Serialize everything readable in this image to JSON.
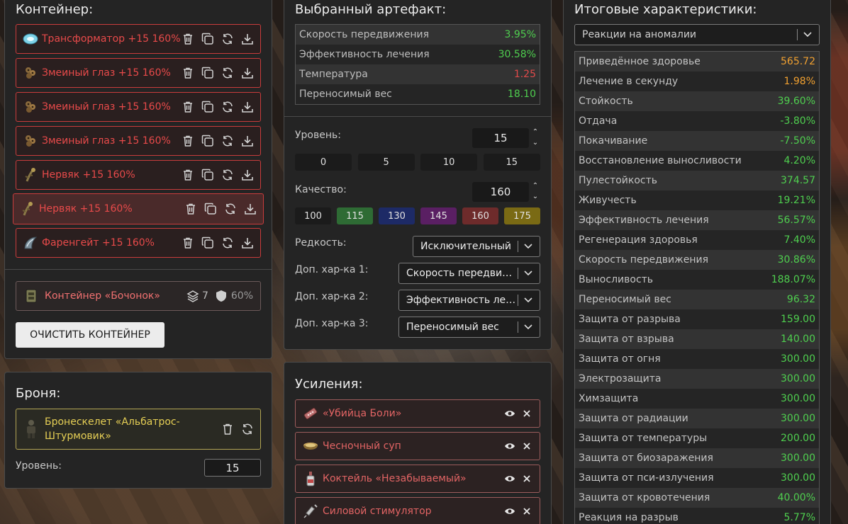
{
  "container_panel": {
    "title": "Контейнер:",
    "items": [
      {
        "name": "Трансформатор +15 160%",
        "icon": "transformer-artifact-icon"
      },
      {
        "name": "Змеиный глаз +15 160%",
        "icon": "snake-eye-artifact-icon"
      },
      {
        "name": "Змеиный глаз +15 160%",
        "icon": "snake-eye-artifact-icon"
      },
      {
        "name": "Змеиный глаз +15 160%",
        "icon": "snake-eye-artifact-icon"
      },
      {
        "name": "Нервяк +15 160%",
        "icon": "nervyak-artifact-icon"
      },
      {
        "name": "Нервяк +15 160%",
        "icon": "nervyak-artifact-icon"
      },
      {
        "name": "Фаренгейт +15 160%",
        "icon": "fahrenheit-artifact-icon"
      }
    ],
    "container": {
      "name": "Контейнер «Бочонок»",
      "slots": "7",
      "protection": "60%"
    },
    "clear_button": "ОЧИСТИТЬ КОНТЕЙНЕР"
  },
  "armor_panel": {
    "title": "Броня:",
    "armor_name": "Бронескелет «Альбатрос-Штурмовик»",
    "level_label": "Уровень:",
    "level_value": "15"
  },
  "artifact_panel": {
    "title": "Выбранный артефакт:",
    "stats": [
      {
        "label": "Скорость передвижения",
        "value": "3.95%",
        "color": "green"
      },
      {
        "label": "Эффективность лечения",
        "value": "30.58%",
        "color": "green"
      },
      {
        "label": "Температура",
        "value": "1.25",
        "color": "red"
      },
      {
        "label": "Переносимый вес",
        "value": "18.10",
        "color": "green"
      }
    ],
    "level_label": "Уровень:",
    "level_value": "15",
    "level_presets": [
      "0",
      "5",
      "10",
      "15"
    ],
    "quality_label": "Качество:",
    "quality_value": "160",
    "quality_presets": [
      {
        "label": "100",
        "color": "#1b1b1b"
      },
      {
        "label": "115",
        "color": "#2e6b34"
      },
      {
        "label": "130",
        "color": "#1d2a66"
      },
      {
        "label": "145",
        "color": "#5a1f63"
      },
      {
        "label": "160",
        "color": "#6e2b2b"
      },
      {
        "label": "175",
        "color": "#7a6a14"
      }
    ],
    "rarity_label": "Редкость:",
    "rarity_value": "Исключительный",
    "extra1_label": "Доп. хар-ка 1:",
    "extra1_value": "Скорость передвижения",
    "extra2_label": "Доп. хар-ка 2:",
    "extra2_value": "Эффективность лечения",
    "extra3_label": "Доп. хар-ка 3:",
    "extra3_value": "Переносимый вес"
  },
  "boosts_panel": {
    "title": "Усиления:",
    "items": [
      {
        "name": "«Убийца Боли»",
        "icon": "painkiller-pills-icon"
      },
      {
        "name": "Чесночный суп",
        "icon": "garlic-soup-icon"
      },
      {
        "name": "Коктейль «Незабываемый»",
        "icon": "cocktail-bottle-icon"
      },
      {
        "name": "Силовой стимулятор",
        "icon": "stimulator-syringe-icon"
      }
    ]
  },
  "totals_panel": {
    "title": "Итоговые характеристики:",
    "filter_value": "Реакции на аномалии",
    "stats": [
      {
        "label": "Приведённое здоровье",
        "value": "565.72",
        "color": "orange"
      },
      {
        "label": "Лечение в секунду",
        "value": "1.98%",
        "color": "orange"
      },
      {
        "label": "Стойкость",
        "value": "39.60%",
        "color": "green"
      },
      {
        "label": "Отдача",
        "value": "-3.80%",
        "color": "green"
      },
      {
        "label": "Покачивание",
        "value": "-7.50%",
        "color": "green"
      },
      {
        "label": "Восстановление выносливости",
        "value": "4.20%",
        "color": "green"
      },
      {
        "label": "Пулестойкость",
        "value": "374.57",
        "color": "green"
      },
      {
        "label": "Живучесть",
        "value": "19.21%",
        "color": "green"
      },
      {
        "label": "Эффективность лечения",
        "value": "56.57%",
        "color": "green"
      },
      {
        "label": "Регенерация здоровья",
        "value": "7.40%",
        "color": "green"
      },
      {
        "label": "Скорость передвижения",
        "value": "30.86%",
        "color": "green"
      },
      {
        "label": "Выносливость",
        "value": "188.07%",
        "color": "green"
      },
      {
        "label": "Переносимый вес",
        "value": "96.32",
        "color": "green"
      },
      {
        "label": "Защита от разрыва",
        "value": "159.00",
        "color": "green"
      },
      {
        "label": "Защита от взрыва",
        "value": "140.00",
        "color": "green"
      },
      {
        "label": "Защита от огня",
        "value": "300.00",
        "color": "green"
      },
      {
        "label": "Электрозащита",
        "value": "300.00",
        "color": "green"
      },
      {
        "label": "Химзащита",
        "value": "300.00",
        "color": "green"
      },
      {
        "label": "Защита от радиации",
        "value": "300.00",
        "color": "green"
      },
      {
        "label": "Защита от температуры",
        "value": "200.00",
        "color": "green"
      },
      {
        "label": "Защита от биозаражения",
        "value": "300.00",
        "color": "green"
      },
      {
        "label": "Защита от пси-излучения",
        "value": "300.00",
        "color": "green"
      },
      {
        "label": "Защита от кровотечения",
        "value": "40.00%",
        "color": "green"
      },
      {
        "label": "Реакция на разрыв",
        "value": "5.77%",
        "color": "green"
      }
    ]
  }
}
